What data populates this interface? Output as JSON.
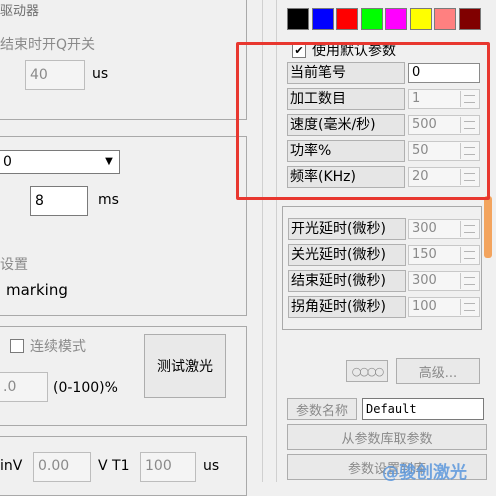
{
  "left": {
    "group1_title": "驱动器",
    "open_q_label": "结束时开Q开关",
    "open_q_value": "40",
    "open_q_unit": "us",
    "select_value": "0",
    "ms_value": "8",
    "ms_unit": "ms",
    "settings_title": "设置",
    "marking_label": "marking",
    "continuous_label": "连续模式",
    "percent_value": ".0",
    "percent_range": "(0-100)%",
    "test_laser_button": "测试激光",
    "minv_label": "inV",
    "minv_value": "0.00",
    "vt1_label": "V T1",
    "vt1_value": "100",
    "vt1_unit": "us"
  },
  "right": {
    "colors": [
      "#000000",
      "#0000ff",
      "#ff0000",
      "#00ff00",
      "#ff00ff",
      "#ffff00",
      "#ff8080",
      "#800000"
    ],
    "use_default_checkbox": "使用默认参数",
    "params": [
      {
        "label": "当前笔号",
        "value": "0",
        "enabled": true,
        "spinner": false
      },
      {
        "label": "加工数目",
        "value": "1",
        "enabled": false,
        "spinner": true
      },
      {
        "label": "速度(毫米/秒)",
        "value": "500",
        "enabled": false,
        "spinner": true
      },
      {
        "label": "功率%",
        "value": "50",
        "enabled": false,
        "spinner": true
      },
      {
        "label": "频率(KHz)",
        "value": "20",
        "enabled": false,
        "spinner": true
      }
    ],
    "delays": [
      {
        "label": "开光延时(微秒)",
        "value": "300"
      },
      {
        "label": "关光延时(微秒)",
        "value": "150"
      },
      {
        "label": "结束延时(微秒)",
        "value": "300"
      },
      {
        "label": "拐角延时(微秒)",
        "value": "100"
      }
    ],
    "advanced_button": "高级...",
    "param_name_label": "参数名称",
    "param_name_value": "Default",
    "load_from_library": "从参数库取参数",
    "save_to_library": "参数设置到库",
    "watermark": "@骏创激光"
  }
}
